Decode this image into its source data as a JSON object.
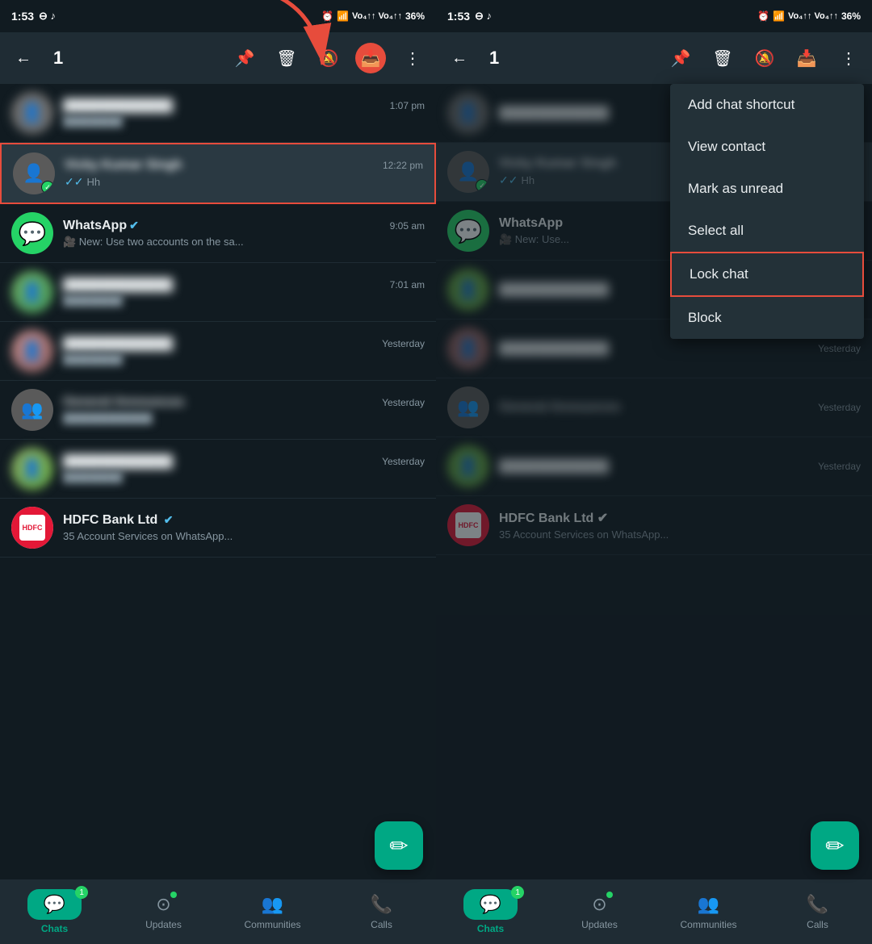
{
  "left_panel": {
    "status_bar": {
      "time": "1:53",
      "battery": "36%"
    },
    "toolbar": {
      "back_label": "←",
      "count": "1",
      "pin_icon": "📌",
      "delete_icon": "🗑",
      "mute_icon": "🔕",
      "archive_icon": "📥",
      "more_icon": "⋮"
    },
    "chats": [
      {
        "id": "chat-1",
        "name": "Blurred Contact 1",
        "time": "1:07 pm",
        "preview": "",
        "blurred": true,
        "verified": false,
        "avatar_type": "person"
      },
      {
        "id": "chat-2",
        "name": "Vicky Kumar Singh",
        "time": "12:22 pm",
        "preview": "Hh",
        "blurred": false,
        "verified": false,
        "avatar_type": "person",
        "selected": true
      },
      {
        "id": "chat-3",
        "name": "WhatsApp",
        "time": "9:05 am",
        "preview": "🎥 New: Use two accounts on the sa...",
        "blurred": false,
        "verified": true,
        "avatar_type": "whatsapp"
      },
      {
        "id": "chat-4",
        "name": "Blurred Contact 2",
        "time": "7:01 am",
        "preview": "",
        "blurred": true,
        "verified": false,
        "avatar_type": "person"
      },
      {
        "id": "chat-5",
        "name": "Dolly Singh",
        "time": "Yesterday",
        "preview": "",
        "blurred": true,
        "verified": false,
        "avatar_type": "person"
      },
      {
        "id": "chat-6",
        "name": "General Announces",
        "time": "Yesterday",
        "preview": "",
        "blurred": true,
        "verified": false,
        "avatar_type": "group"
      },
      {
        "id": "chat-7",
        "name": "Blurred Contact 3",
        "time": "Yesterday",
        "preview": "",
        "blurred": true,
        "verified": false,
        "avatar_type": "person"
      },
      {
        "id": "chat-8",
        "name": "HDFC Bank Ltd",
        "time": "",
        "preview": "35 Account Services on WhatsApp...",
        "blurred": false,
        "verified": true,
        "avatar_type": "hdfc"
      }
    ],
    "bottom_nav": [
      {
        "id": "chats",
        "label": "Chats",
        "icon": "💬",
        "active": true,
        "badge": "1"
      },
      {
        "id": "updates",
        "label": "Updates",
        "icon": "⊙",
        "active": false,
        "dot": true
      },
      {
        "id": "communities",
        "label": "Communities",
        "icon": "👥",
        "active": false
      },
      {
        "id": "calls",
        "label": "Calls",
        "icon": "📞",
        "active": false
      }
    ],
    "fab": "+"
  },
  "right_panel": {
    "status_bar": {
      "time": "1:53",
      "battery": "36%"
    },
    "toolbar": {
      "back_label": "←",
      "count": "1"
    },
    "dropdown_menu": {
      "items": [
        {
          "id": "add-shortcut",
          "label": "Add chat shortcut",
          "highlighted": false
        },
        {
          "id": "view-contact",
          "label": "View contact",
          "highlighted": false
        },
        {
          "id": "mark-unread",
          "label": "Mark as unread",
          "highlighted": false
        },
        {
          "id": "select-all",
          "label": "Select all",
          "highlighted": false
        },
        {
          "id": "lock-chat",
          "label": "Lock chat",
          "highlighted": true
        },
        {
          "id": "block",
          "label": "Block",
          "highlighted": false
        }
      ]
    },
    "bottom_nav": [
      {
        "id": "chats",
        "label": "Chats",
        "icon": "💬",
        "active": true,
        "badge": "1"
      },
      {
        "id": "updates",
        "label": "Updates",
        "icon": "⊙",
        "active": false,
        "dot": true
      },
      {
        "id": "communities",
        "label": "Communities",
        "icon": "👥",
        "active": false
      },
      {
        "id": "calls",
        "label": "Calls",
        "icon": "📞",
        "active": false
      }
    ]
  },
  "arrow": {
    "color": "#e74c3c"
  }
}
